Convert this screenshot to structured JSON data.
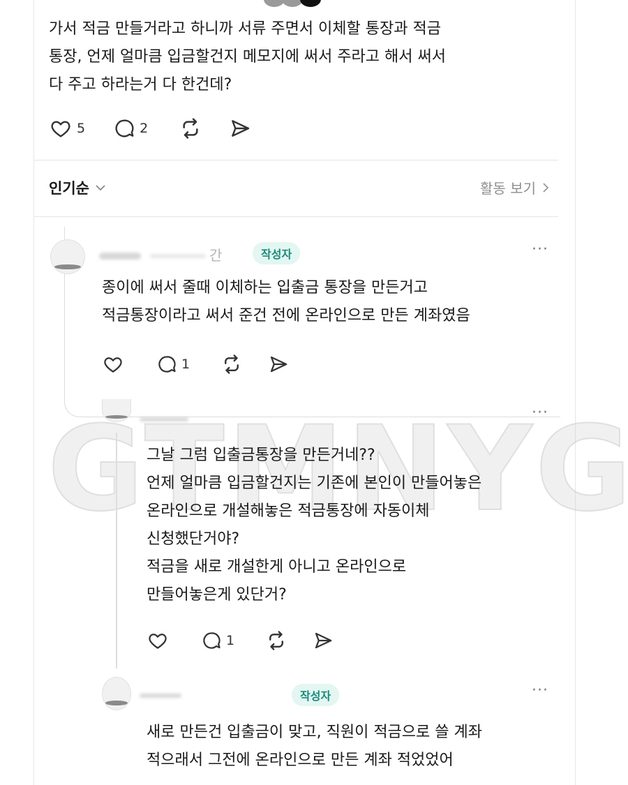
{
  "post": {
    "lines": [
      "가서 적금 만들거라고 하니까 서류 주면서 이체할 통장과 적금",
      "통장, 언제 얼마큼 입금할건지 메모지에 써서 주라고 해서 써서",
      "다 주고 하라는거 다 한건데?"
    ],
    "like_count": "5",
    "reply_count": "2"
  },
  "sort": {
    "label": "인기순"
  },
  "activity": {
    "label": "활동 보기"
  },
  "comments": [
    {
      "badge": "작성자",
      "time_fragment": "간",
      "lines": [
        "종이에 써서 줄때 이체하는 입출금 통장을 만든거고",
        "적금통장이라고 써서 준건 전에 온라인으로 만든 계좌였음"
      ],
      "reply_count": "1"
    },
    {
      "lines": [
        "그날 그럼 입출금통장을 만든거네??",
        "언제 얼마큼 입금할건지는 기존에 본인이 만들어놓은",
        "온라인으로 개설해놓은 적금통장에 자동이체",
        "신청했단거야?",
        "적금을 새로 개설한게 아니고 온라인으로",
        "만들어놓은게 있단거?"
      ],
      "reply_count": "1"
    },
    {
      "badge": "작성자",
      "lines": [
        "새로 만든건 입출금이 맞고, 직원이 적금으로 쓸 계좌",
        "적으래서 그전에 온라인으로 만든 계좌 적었었어"
      ]
    }
  ],
  "watermark": "GTMNYG",
  "more_glyph": "···",
  "icons": [
    "heart-icon",
    "reply-icon",
    "repost-icon",
    "share-icon",
    "chevron-down-icon",
    "chevron-right-icon",
    "more-icon"
  ],
  "colors": {
    "badge_text": "#1d8a7a",
    "badge_bg": "#e3f6f2",
    "muted": "#8e8e8e"
  }
}
